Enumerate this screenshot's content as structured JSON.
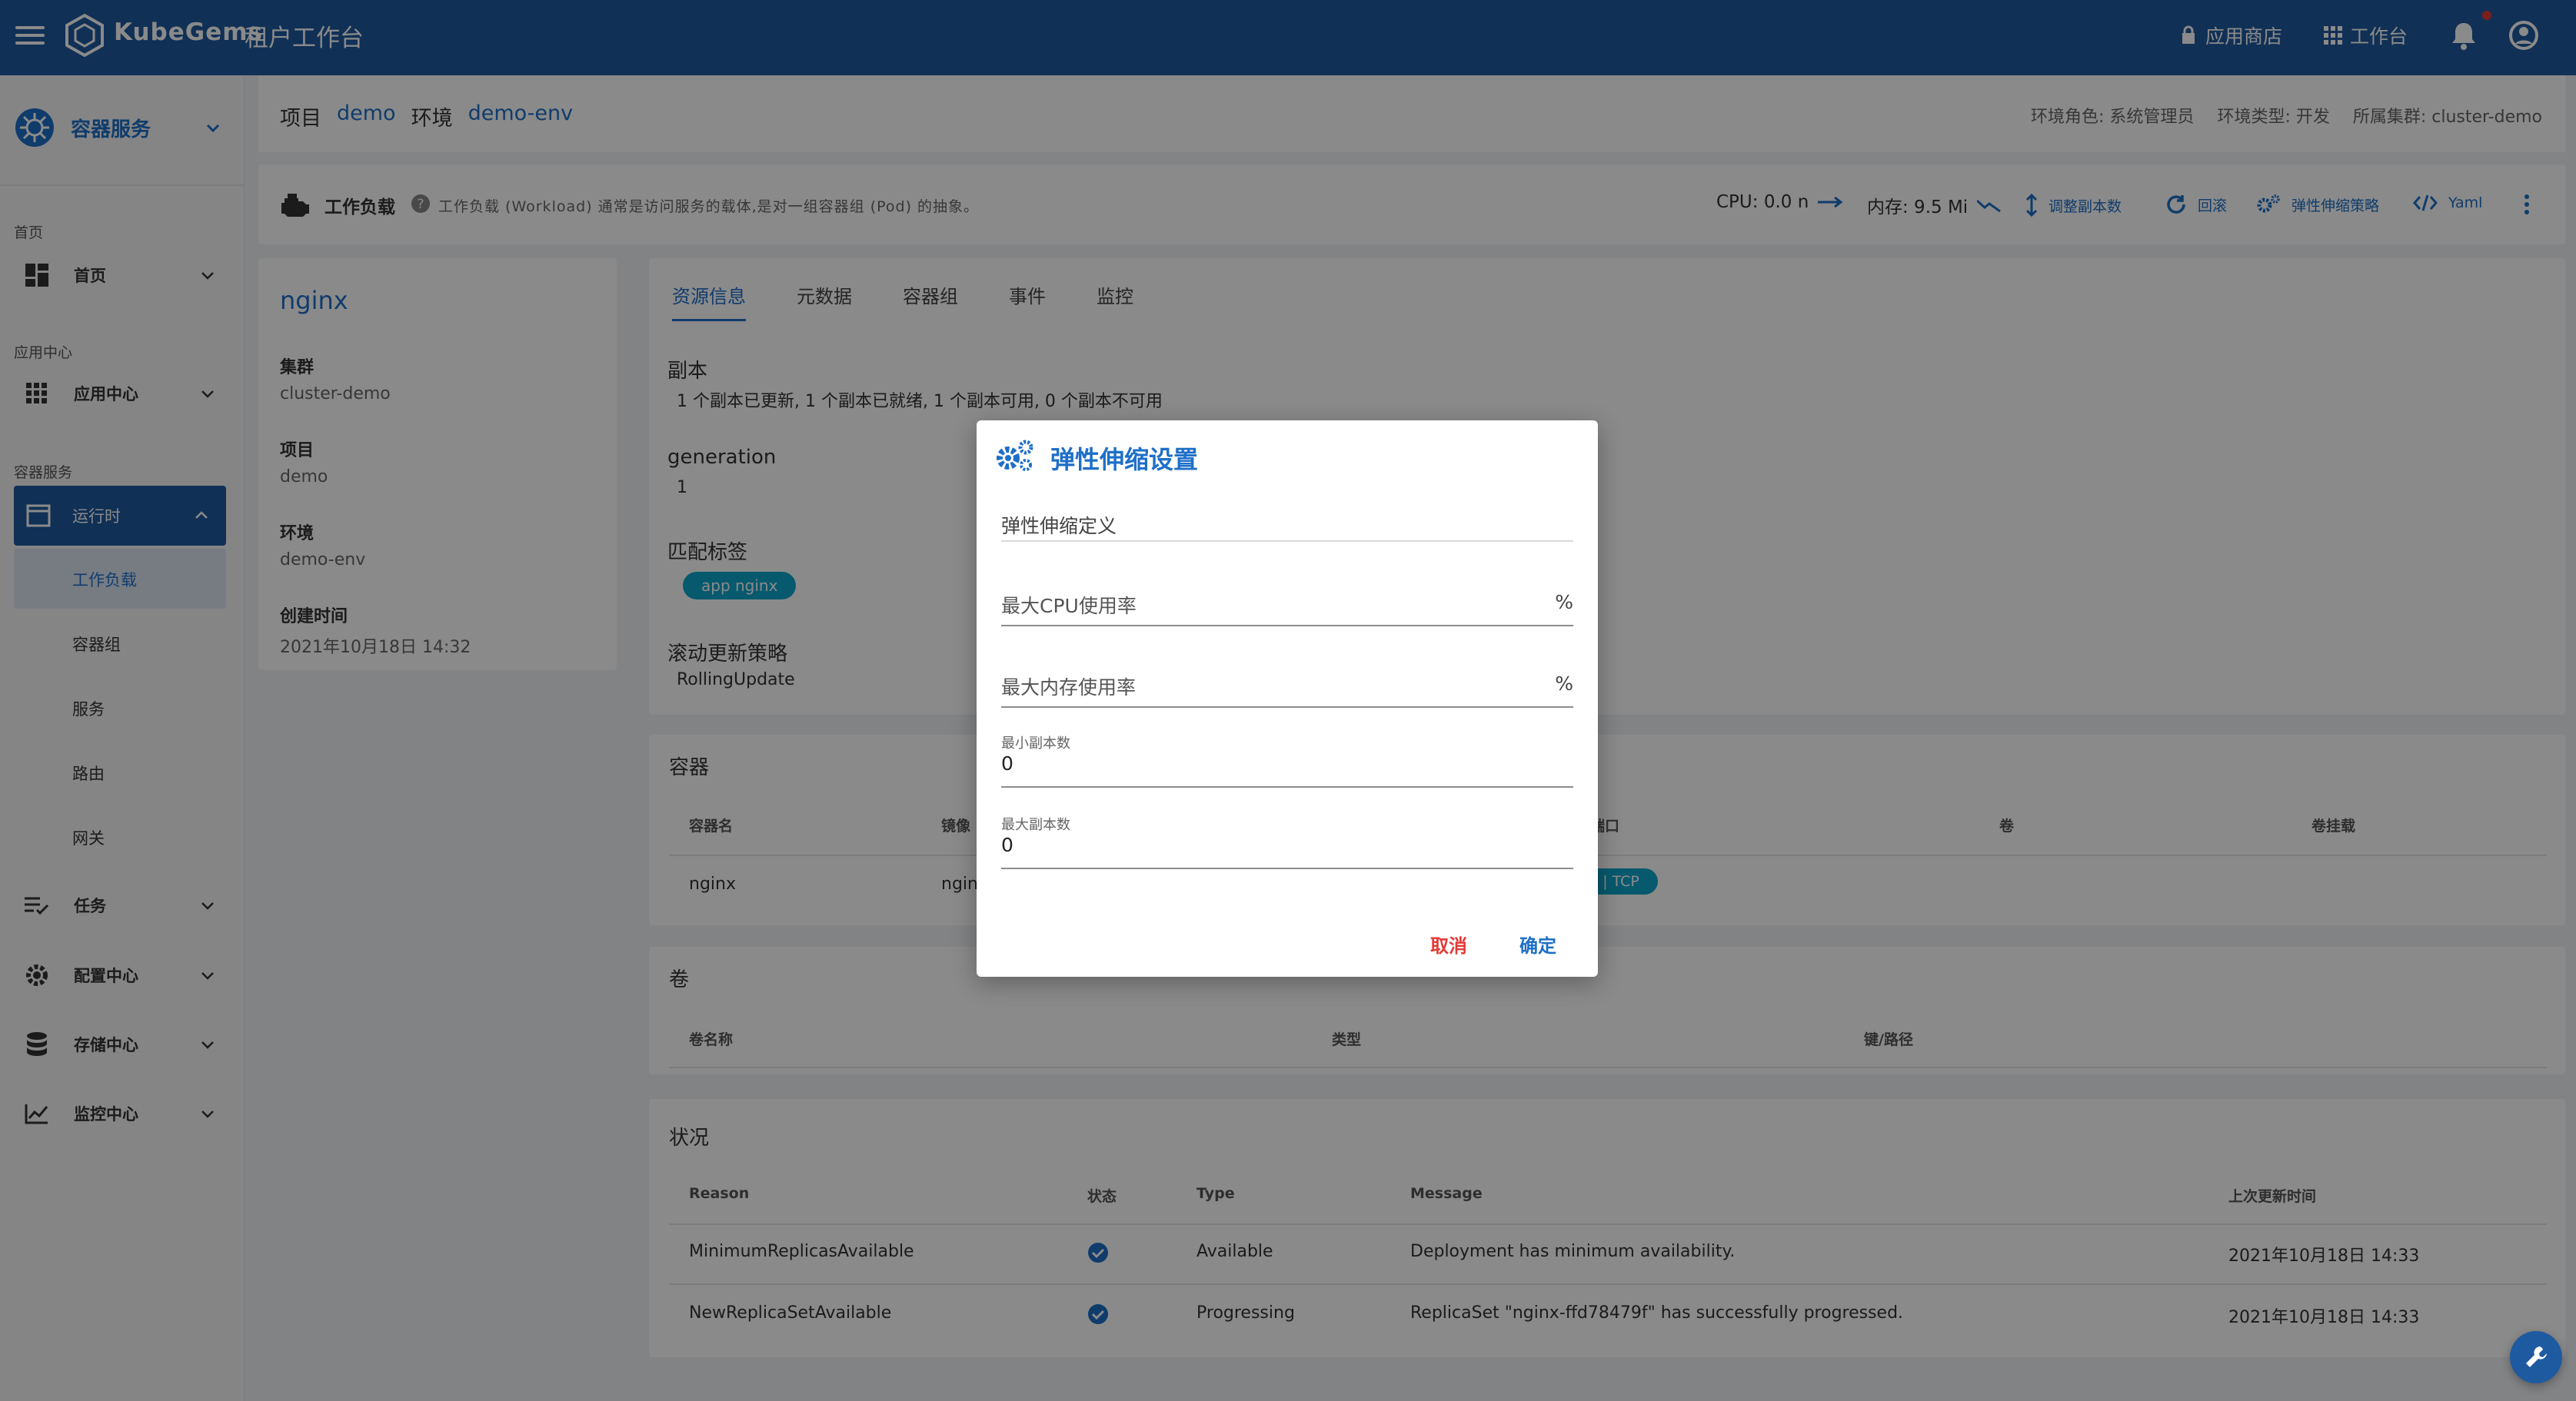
{
  "topbar": {
    "brand": "KubeGems",
    "subtitle": "租户工作台",
    "app_store": "应用商店",
    "workbench": "工作台"
  },
  "sidebar": {
    "module": "容器服务",
    "sections": {
      "home": "首页",
      "app_center": "应用中心",
      "container": "容器服务"
    },
    "items": {
      "home": "首页",
      "app_center": "应用中心",
      "runtime": "运行时",
      "tasks": "任务",
      "config": "配置中心",
      "storage": "存储中心",
      "monitor": "监控中心"
    },
    "runtime_children": [
      "工作负载",
      "容器组",
      "服务",
      "路由",
      "网关"
    ]
  },
  "header": {
    "project_label": "项目",
    "project": "demo",
    "env_label": "环境",
    "env": "demo-env",
    "role": "环境角色: 系统管理员",
    "env_type": "环境类型: 开发",
    "cluster": "所属集群: cluster-demo"
  },
  "toolbar": {
    "title": "工作负载",
    "description": "工作负载 (Workload) 通常是访问服务的载体,是对一组容器组 (Pod) 的抽象。",
    "cpu": "CPU: 0.0 n",
    "memory": "内存: 9.5 Mi",
    "scale": "调整副本数",
    "rollback": "回滚",
    "hpa": "弹性伸缩策略",
    "yaml": "Yaml"
  },
  "info": {
    "name": "nginx",
    "cluster_label": "集群",
    "cluster": "cluster-demo",
    "project_label": "项目",
    "project": "demo",
    "env_label": "环境",
    "env": "demo-env",
    "created_label": "创建时间",
    "created": "2021年10月18日 14:32"
  },
  "tabs": [
    "资源信息",
    "元数据",
    "容器组",
    "事件",
    "监控"
  ],
  "resource": {
    "replicas_label": "副本",
    "replicas": "1 个副本已更新, 1 个副本已就绪, 1 个副本可用, 0 个副本不可用",
    "generation_label": "generation",
    "generation": "1",
    "labels_label": "匹配标签",
    "label_chip": "app nginx",
    "strategy_label": "滚动更新策略",
    "strategy": "RollingUpdate"
  },
  "containers": {
    "title": "容器",
    "headers": [
      "容器名",
      "镜像",
      "容器端口",
      "卷",
      "卷挂载"
    ],
    "row": {
      "name": "nginx",
      "image": "ngin",
      "port": "80 | TCP"
    }
  },
  "volumes": {
    "title": "卷",
    "headers": [
      "卷名称",
      "类型",
      "键/路径"
    ]
  },
  "status": {
    "title": "状况",
    "headers": [
      "Reason",
      "状态",
      "Type",
      "Message",
      "上次更新时间"
    ],
    "rows": [
      {
        "reason": "MinimumReplicasAvailable",
        "type": "Available",
        "message": "Deployment has minimum availability.",
        "time": "2021年10月18日 14:33"
      },
      {
        "reason": "NewReplicaSetAvailable",
        "type": "Progressing",
        "message": "ReplicaSet \"nginx-ffd78479f\" has successfully progressed.",
        "time": "2021年10月18日 14:33"
      }
    ]
  },
  "dialog": {
    "title": "弹性伸缩设置",
    "section": "弹性伸缩定义",
    "max_cpu": "最大CPU使用率",
    "max_mem": "最大内存使用率",
    "percent": "%",
    "min_replicas_label": "最小副本数",
    "min_replicas": "0",
    "max_replicas_label": "最大副本数",
    "max_replicas": "0",
    "cancel": "取消",
    "confirm": "确定"
  },
  "colors": {
    "primary": "#1e5aa0",
    "accent": "#1e6fc8",
    "chip": "#0ea5c9",
    "cancel": "#e53935"
  }
}
